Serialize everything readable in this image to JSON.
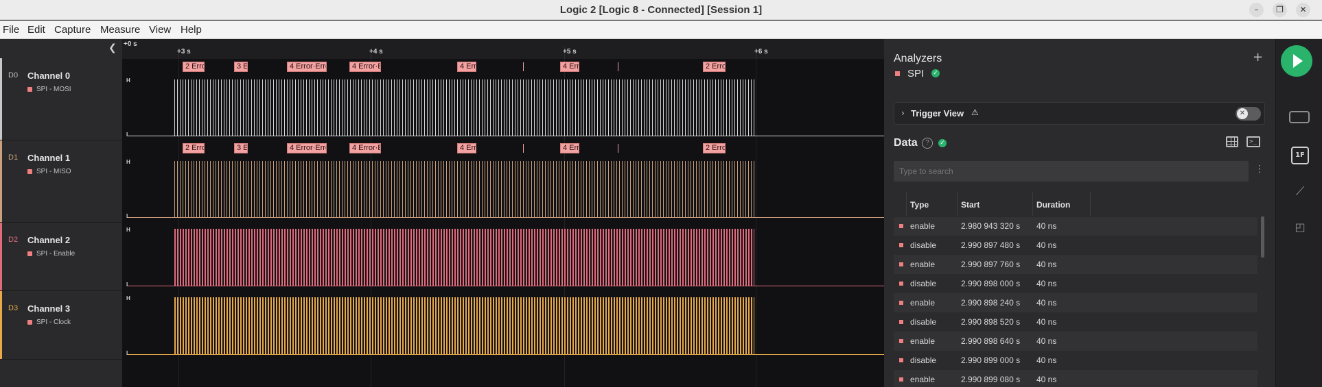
{
  "window": {
    "title": "Logic 2 [Logic 8 - Connected] [Session 1]"
  },
  "menu": [
    "File",
    "Edit",
    "Capture",
    "Measure",
    "View",
    "Help"
  ],
  "ruler": {
    "origin": "+0 s",
    "ticks": [
      "+3 s",
      "+4 s",
      "+5 s",
      "+6 s"
    ]
  },
  "channels": [
    {
      "id": "D0",
      "name": "Channel 0",
      "analyzer": "SPI - MOSI",
      "color": "#c8c8c8"
    },
    {
      "id": "D1",
      "name": "Channel 1",
      "analyzer": "SPI - MISO",
      "color": "#c9a07e"
    },
    {
      "id": "D2",
      "name": "Channel 2",
      "analyzer": "SPI - Enable",
      "color": "#e16b7d"
    },
    {
      "id": "D3",
      "name": "Channel 3",
      "analyzer": "SPI - Clock",
      "color": "#e8a94a"
    }
  ],
  "levels": {
    "high": "H",
    "low": "L"
  },
  "frames": [
    "2 Erro",
    "3 E",
    "4 Error·Erro",
    "4 Error·E",
    "4 Err",
    "4 Err",
    "2 Erro"
  ],
  "sidebar": {
    "analyzers_title": "Analyzers",
    "analyzer_name": "SPI",
    "trigger_view": "Trigger View",
    "data_title": "Data",
    "search_placeholder": "Type to search",
    "columns": [
      "Type",
      "Start",
      "Duration"
    ],
    "rows": [
      {
        "type": "enable",
        "start": "2.980 943 320 s",
        "duration": "40 ns"
      },
      {
        "type": "disable",
        "start": "2.990 897 480 s",
        "duration": "40 ns"
      },
      {
        "type": "enable",
        "start": "2.990 897 760 s",
        "duration": "40 ns"
      },
      {
        "type": "disable",
        "start": "2.990 898 000 s",
        "duration": "40 ns"
      },
      {
        "type": "enable",
        "start": "2.990 898 240 s",
        "duration": "40 ns"
      },
      {
        "type": "disable",
        "start": "2.990 898 520 s",
        "duration": "40 ns"
      },
      {
        "type": "enable",
        "start": "2.990 898 640 s",
        "duration": "40 ns"
      },
      {
        "type": "disable",
        "start": "2.990 899 000 s",
        "duration": "40 ns"
      },
      {
        "type": "enable",
        "start": "2.990 899 080 s",
        "duration": "40 ns"
      }
    ]
  },
  "icons": {
    "add": "plus-icon",
    "play": "play-icon",
    "help": "help-circle-icon",
    "grid": "table-icon",
    "terminal": "terminal-icon"
  }
}
